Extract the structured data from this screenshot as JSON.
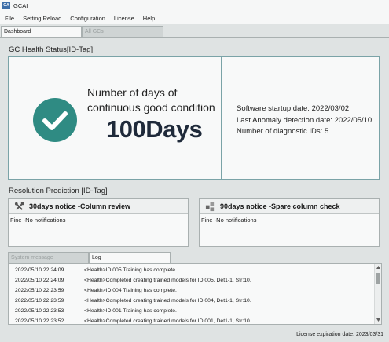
{
  "window": {
    "app_icon_text": "GA",
    "title": "GCAI"
  },
  "menu": [
    "File",
    "Setting Reload",
    "Configuration",
    "License",
    "Help"
  ],
  "tabs": {
    "dashboard": "Dashboard",
    "all_gcs": "All GCs"
  },
  "health": {
    "section_title": "GC Health Status[ID-Tag]",
    "caption_line1": "Number of days of",
    "caption_line2": "continuous good condition",
    "days_value": "100Days",
    "startup_label": "Software startup date:",
    "startup_value": "2022/03/02",
    "anomaly_label": "Last Anomaly detection date:",
    "anomaly_value": "2022/05/10",
    "ids_label": "Number of diagnostic IDs:",
    "ids_value": "5",
    "icon": "checkmark-icon",
    "accent_color": "#2f8b83"
  },
  "prediction": {
    "section_title": "Resolution Prediction [ID-Tag]",
    "notice_30": {
      "icon": "tools-icon",
      "title": "30days notice -Column review",
      "body": "Fine -No notifications"
    },
    "notice_90": {
      "icon": "parts-icon",
      "title": "90days notice -Spare column check",
      "body": "Fine -No notifications"
    }
  },
  "log_tabs": {
    "system_message": "System message",
    "log": "Log"
  },
  "log_entries": [
    {
      "ts": "2022/05/10 22:24:09",
      "msg": "<Health>ID:005 Training has complete."
    },
    {
      "ts": "2022/05/10 22:24:09",
      "msg": "<Health>Completed creating trained models for ID:005, Det1-1, Str:10."
    },
    {
      "ts": "2022/05/10 22:23:59",
      "msg": "<Health>ID:004 Training has complete."
    },
    {
      "ts": "2022/05/10 22:23:59",
      "msg": "<Health>Completed creating trained models for ID:004, Det1-1, Str:10."
    },
    {
      "ts": "2022/05/10 22:23:53",
      "msg": "<Health>ID:001 Training has complete."
    },
    {
      "ts": "2022/05/10 22:23:52",
      "msg": "<Health>Completed creating trained models for ID:001, Det1-1, Str:10."
    }
  ],
  "status": {
    "license_expiration": "License expiration date: 2023/03/31"
  }
}
